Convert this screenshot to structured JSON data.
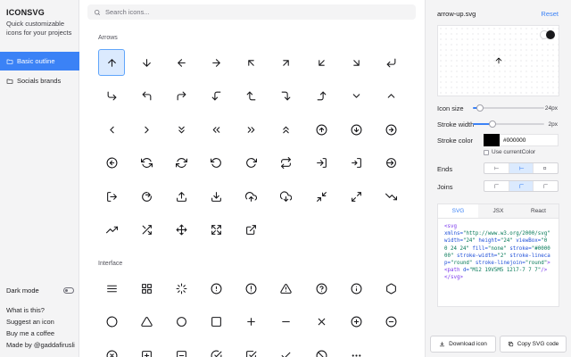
{
  "sidebar": {
    "brand": "ICONSVG",
    "tagline": "Quick customizable icons for your projects",
    "nav": [
      {
        "label": "Basic outline",
        "icon": "folder-icon",
        "active": true
      },
      {
        "label": "Socials brands",
        "icon": "folder-icon",
        "active": false
      }
    ],
    "dark_mode_label": "Dark mode",
    "links": [
      "What is this?",
      "Suggest an icon",
      "Buy me a coffee",
      "Made by @gaddafirusli"
    ]
  },
  "search": {
    "placeholder": "Search icons..."
  },
  "sections": [
    {
      "title": "Arrows",
      "icons": [
        "arrow-up",
        "arrow-down",
        "arrow-left",
        "arrow-right",
        "arrow-up-left",
        "arrow-up-right",
        "arrow-down-left",
        "arrow-down-right",
        "corner-down-left",
        "corner-down-right",
        "corner-up-left",
        "corner-up-right",
        "corner-left-down",
        "corner-left-up",
        "corner-right-down",
        "corner-right-up",
        "chevron-down",
        "chevron-up",
        "chevron-left",
        "chevron-right",
        "chevrons-down",
        "chevrons-left",
        "chevrons-right",
        "chevrons-up",
        "arrow-up-circle",
        "arrow-down-circle",
        "arrow-right-circle",
        "arrow-left-circle",
        "refresh-ccw",
        "refresh-cw",
        "rotate-ccw",
        "rotate-cw",
        "repeat",
        "log-in",
        "log-in-alt",
        "arrow-right-circle-alt",
        "log-out",
        "share-alt",
        "upload",
        "download",
        "upload-cloud",
        "download-cloud",
        "minimize",
        "maximize",
        "trending-down",
        "trending-up",
        "shuffle",
        "move",
        "maximize-alt",
        "external-link"
      ],
      "selected": "arrow-up"
    },
    {
      "title": "Interface",
      "icons": [
        "menu",
        "grid",
        "loader",
        "alert-circle",
        "alert-octagon",
        "alert-triangle",
        "help-circle",
        "info",
        "hexagon",
        "circle",
        "triangle",
        "circle-alt",
        "square",
        "plus",
        "minus",
        "x",
        "plus-circle",
        "minus-circle",
        "x-circle",
        "plus-square",
        "minus-square",
        "check-circle",
        "check-square",
        "check",
        "slash",
        "more-horizontal"
      ]
    }
  ],
  "panel": {
    "file_name": "arrow-up.svg",
    "reset_label": "Reset",
    "preview_icon": "arrow-up",
    "icon_size_label": "Icon size",
    "icon_size_value": "24px",
    "icon_size_fraction": 0.1,
    "stroke_width_label": "Stroke width",
    "stroke_width_value": "2px",
    "stroke_width_fraction": 0.28,
    "stroke_color_label": "Stroke color",
    "stroke_color_value": "#000000",
    "use_current_color_label": "Use currentColor",
    "ends_label": "Ends",
    "joins_label": "Joins",
    "ends_selected": 1,
    "joins_selected": 1,
    "code_tabs": [
      "SVG",
      "JSX",
      "React"
    ],
    "code_tab_active": 0,
    "download_label": "Download icon",
    "copy_label": "Copy SVG code"
  },
  "accent_color": "#3b82f6"
}
